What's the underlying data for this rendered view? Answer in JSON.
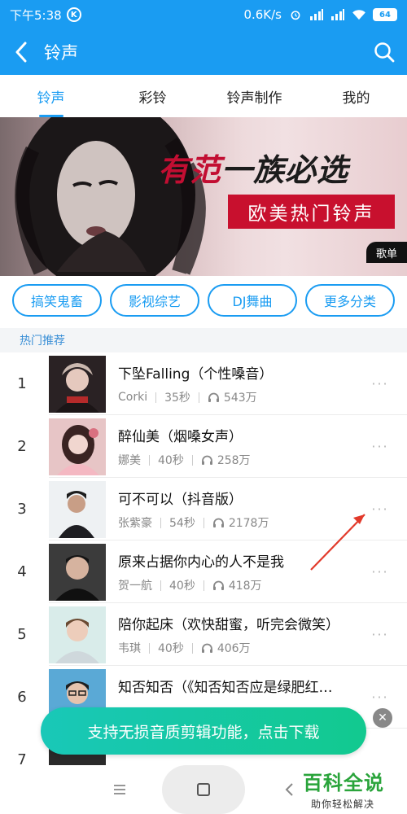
{
  "status_bar": {
    "time": "下午5:38",
    "k_badge": "K",
    "speed": "0.6K/s",
    "battery": "64"
  },
  "app_bar": {
    "title": "铃声",
    "back_icon": "chevron-left-icon",
    "search_icon": "search-icon"
  },
  "tabs": [
    {
      "label": "铃声",
      "active": true
    },
    {
      "label": "彩铃",
      "active": false
    },
    {
      "label": "铃声制作",
      "active": false
    },
    {
      "label": "我的",
      "active": false
    }
  ],
  "banner": {
    "headline_red": "有范",
    "headline_black": "一族必选",
    "subtitle": "欧美热门铃声",
    "tag": "歌单"
  },
  "categories": [
    "搞笑鬼畜",
    "影视综艺",
    "DJ舞曲",
    "更多分类"
  ],
  "section": {
    "title": "热门推荐"
  },
  "songs": [
    {
      "rank": "1",
      "title": "下坠Falling（个性嗓音）",
      "artist": "Corki",
      "duration": "35秒",
      "plays": "543万"
    },
    {
      "rank": "2",
      "title": "醉仙美（烟嗓女声）",
      "artist": "娜美",
      "duration": "40秒",
      "plays": "258万"
    },
    {
      "rank": "3",
      "title": "可不可以（抖音版）",
      "artist": "张紫豪",
      "duration": "54秒",
      "plays": "2178万"
    },
    {
      "rank": "4",
      "title": "原来占据你内心的人不是我",
      "artist": "贺一航",
      "duration": "40秒",
      "plays": "418万"
    },
    {
      "rank": "5",
      "title": "陪你起床（欢快甜蜜，听完会微笑）",
      "artist": "韦琪",
      "duration": "40秒",
      "plays": "406万"
    },
    {
      "rank": "6",
      "title": "知否知否（《知否知否应是绿肥红…",
      "artist": "",
      "duration": "",
      "plays": ""
    },
    {
      "rank": "7",
      "title": "",
      "artist": "",
      "duration": "",
      "plays": ""
    }
  ],
  "more_label": "···",
  "toast": {
    "text": "支持无损音质剪辑功能，点击下载",
    "close": "✕"
  },
  "watermark": {
    "title": "百科全说",
    "subtitle": "助你轻松解决"
  },
  "colors": {
    "primary": "#1a9cf2",
    "toast": "#12c98f",
    "banner_red": "#c8102e"
  }
}
